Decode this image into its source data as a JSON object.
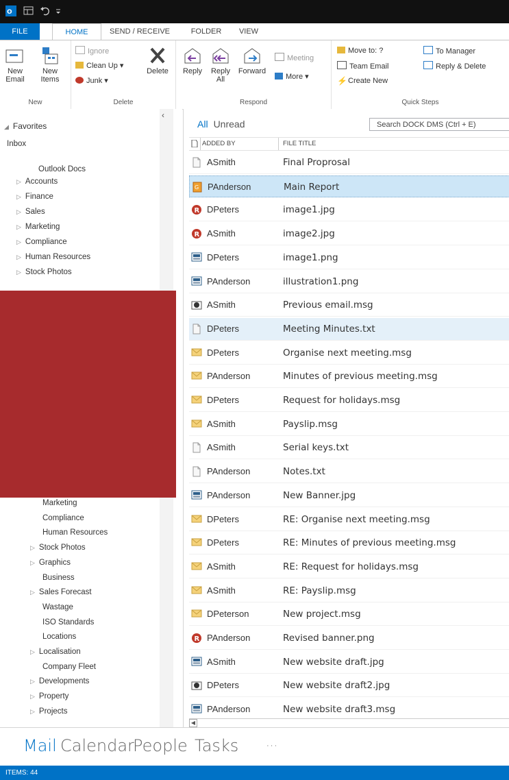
{
  "colors": {
    "accent": "#0072c6",
    "titlebar": "#111111",
    "redacted": "#a72b2d",
    "selected": "#cde6f7"
  },
  "tabs": [
    "FILE",
    "HOME",
    "SEND / RECEIVE",
    "FOLDER",
    "VIEW"
  ],
  "ribbon": {
    "new": {
      "new_email": "New Email",
      "new_items": "New Items",
      "label": "New"
    },
    "delete": {
      "ignore": "Ignore",
      "cleanup": "Clean Up",
      "junk": "Junk",
      "delete": "Delete",
      "label": "Delete"
    },
    "respond": {
      "reply": "Reply",
      "reply_all": "Reply All",
      "forward": "Forward",
      "meeting": "Meeting",
      "more": "More",
      "label": "Respond"
    },
    "quicksteps": {
      "move_to": "Move to: ?",
      "team_email": "Team Email",
      "create_new": "Create New",
      "to_manager": "To Manager",
      "reply_delete": "Reply & Delete",
      "label": "Quick Steps"
    }
  },
  "nav": {
    "favorites": "Favorites",
    "inbox": "Inbox",
    "outlook_docs": "Outlook Docs",
    "top_items": [
      "Accounts",
      "Finance",
      "Sales",
      "Marketing",
      "Compliance",
      "Human Resources",
      "Stock Photos"
    ],
    "bottom_items": [
      "Marketing",
      "Compliance",
      "Human Resources",
      "Stock Photos",
      "Graphics",
      "Business",
      "Sales Forecast",
      "Wastage",
      "ISO Standards",
      "Locations",
      "Localisation",
      "Company Fleet",
      "Developments",
      "Property",
      "Projects"
    ]
  },
  "list": {
    "filter_all": "All",
    "filter_unread": "Unread",
    "search_placeholder": "Search DOCK DMS (Ctrl + E)",
    "col_added_by": "ADDED BY",
    "col_file_title": "FILE TITLE",
    "rows": [
      {
        "by": "ASmith",
        "title": "Final Proprosal",
        "icon": "doc-icon"
      },
      {
        "by": "PAnderson",
        "title": "Main Report",
        "icon": "report-icon"
      },
      {
        "by": "DPeters",
        "title": "image1.jpg",
        "icon": "red-image-icon"
      },
      {
        "by": "ASmith",
        "title": "image2.jpg",
        "icon": "red-image-icon"
      },
      {
        "by": "DPeters",
        "title": "image1.png",
        "icon": "picture-icon"
      },
      {
        "by": "PAnderson",
        "title": "illustration1.png",
        "icon": "picture-icon"
      },
      {
        "by": "ASmith",
        "title": "Previous email.msg",
        "icon": "msg-icon"
      },
      {
        "by": "DPeters",
        "title": "Meeting Minutes.txt",
        "icon": "doc-icon"
      },
      {
        "by": "DPeters",
        "title": "Organise next meeting.msg",
        "icon": "envelope-icon"
      },
      {
        "by": "PAnderson",
        "title": "Minutes of previous meeting.msg",
        "icon": "envelope-icon"
      },
      {
        "by": "DPeters",
        "title": "Request for holidays.msg",
        "icon": "envelope-icon"
      },
      {
        "by": "ASmith",
        "title": "Payslip.msg",
        "icon": "envelope-icon"
      },
      {
        "by": "ASmith",
        "title": "Serial keys.txt",
        "icon": "doc-icon"
      },
      {
        "by": "PAnderson",
        "title": "Notes.txt",
        "icon": "doc-icon"
      },
      {
        "by": "PAnderson",
        "title": "New Banner.jpg",
        "icon": "picture-icon"
      },
      {
        "by": "DPeters",
        "title": "RE: Organise next meeting.msg",
        "icon": "envelope-icon"
      },
      {
        "by": "DPeters",
        "title": "RE: Minutes of previous meeting.msg",
        "icon": "envelope-icon"
      },
      {
        "by": "ASmith",
        "title": "RE: Request for holidays.msg",
        "icon": "envelope-icon"
      },
      {
        "by": "ASmith",
        "title": "RE: Payslip.msg",
        "icon": "envelope-icon"
      },
      {
        "by": "DPeterson",
        "title": "New project.msg",
        "icon": "envelope-icon"
      },
      {
        "by": "PAnderson",
        "title": "Revised banner.png",
        "icon": "red-image-icon"
      },
      {
        "by": "ASmith",
        "title": "New website draft.jpg",
        "icon": "picture-icon"
      },
      {
        "by": "DPeters",
        "title": "New website draft2.jpg",
        "icon": "msg-icon"
      },
      {
        "by": "PAnderson",
        "title": "New website draft3.msg",
        "icon": "picture-icon"
      }
    ]
  },
  "bottom_nav": [
    "Mail",
    "Calendar",
    "People",
    "Tasks",
    "···"
  ],
  "status": "ITEMS: 44"
}
